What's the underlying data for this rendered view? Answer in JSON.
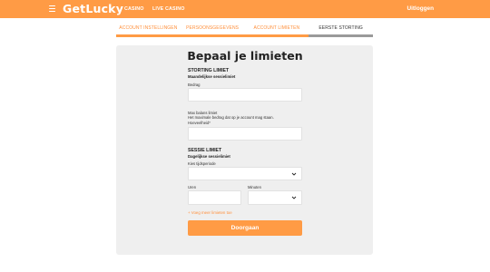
{
  "header": {
    "logo": "GetLucky",
    "nav": [
      "CASINO",
      "LIVE CASINO"
    ],
    "logout_label": "Uitloggen",
    "brand_color": "#ff9b45"
  },
  "steps": [
    {
      "label": "ACCOUNT INSTELLINGEN",
      "state": "completed"
    },
    {
      "label": "PERSOONSGEGEVENS",
      "state": "completed"
    },
    {
      "label": "ACCOUNT LIMIETEN",
      "state": "completed"
    },
    {
      "label": "EERSTE STORTING",
      "state": "current"
    }
  ],
  "form": {
    "title": "Bepaal je limieten",
    "deposit_limit": {
      "title": "STORTING LIMIET",
      "subtitle": "Maandelijkse sessielimiet",
      "amount_label": "Bedrag",
      "amount_value": ""
    },
    "max_balance": {
      "title": "Max balans limiet",
      "description": "Het maximale bedrag dat op je account mag staan.",
      "amount_label": "Hoeveelheid*",
      "amount_value": ""
    },
    "session_limit": {
      "title": "SESSIE LIMIET",
      "subtitle": "Dagelijkse sessielimiet",
      "period_label": "Kies tijdsperiode",
      "period_value": "",
      "hours_label": "Uren",
      "hours_value": "",
      "minutes_label": "Minuten",
      "minutes_value": ""
    },
    "add_more_label": "+ Voeg meer limieten toe",
    "submit_label": "Doorgaan"
  }
}
